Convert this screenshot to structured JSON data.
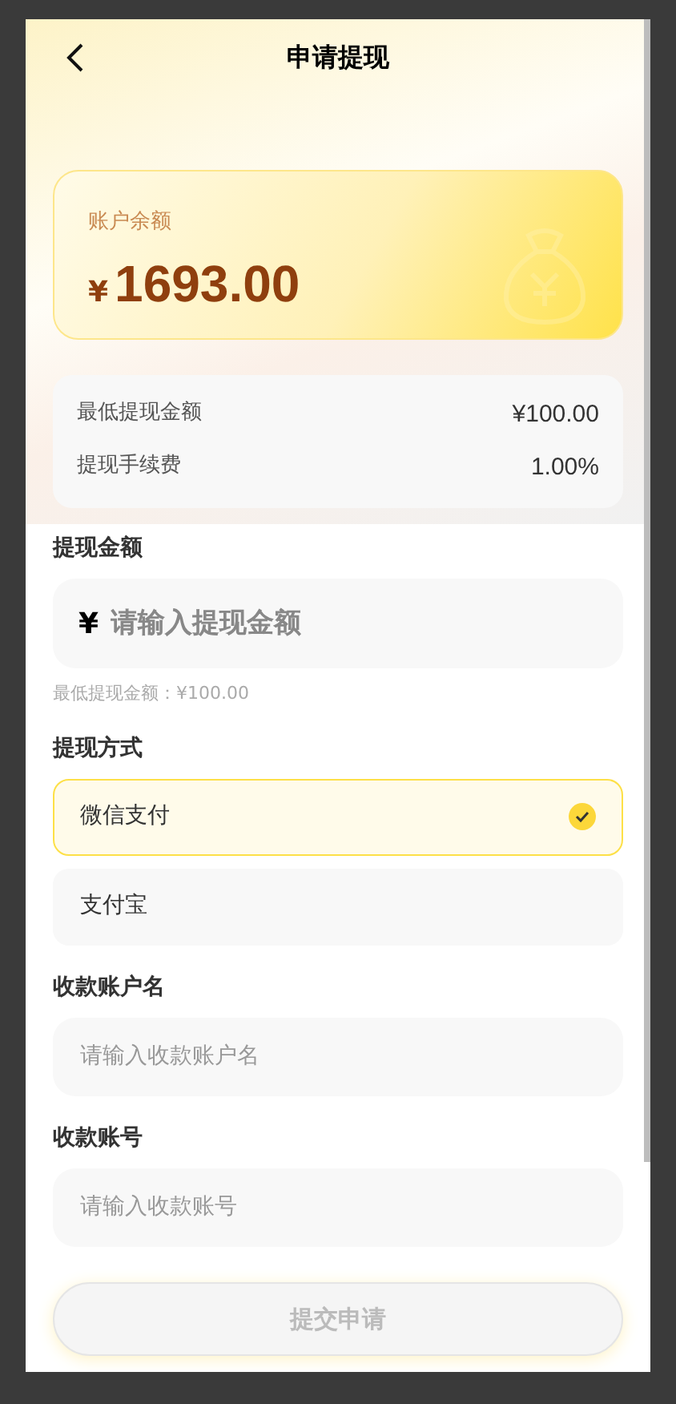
{
  "header": {
    "title": "申请提现"
  },
  "balance": {
    "label": "账户余额",
    "currency": "¥",
    "amount": "1693.00"
  },
  "info": {
    "rows": [
      {
        "label": "最低提现金额",
        "value": "¥100.00"
      },
      {
        "label": "提现手续费",
        "value": "1.00%"
      }
    ]
  },
  "amount": {
    "label": "提现金额",
    "currency": "¥",
    "placeholder": "请输入提现金额",
    "hint": "最低提现金额：¥100.00"
  },
  "method": {
    "label": "提现方式",
    "options": [
      {
        "label": "微信支付",
        "selected": true
      },
      {
        "label": "支付宝",
        "selected": false
      }
    ]
  },
  "fields": [
    {
      "label": "收款账户名",
      "placeholder": "请输入收款账户名"
    },
    {
      "label": "收款账号",
      "placeholder": "请输入收款账号"
    }
  ],
  "submit": {
    "label": "提交申请",
    "disabled": true
  }
}
